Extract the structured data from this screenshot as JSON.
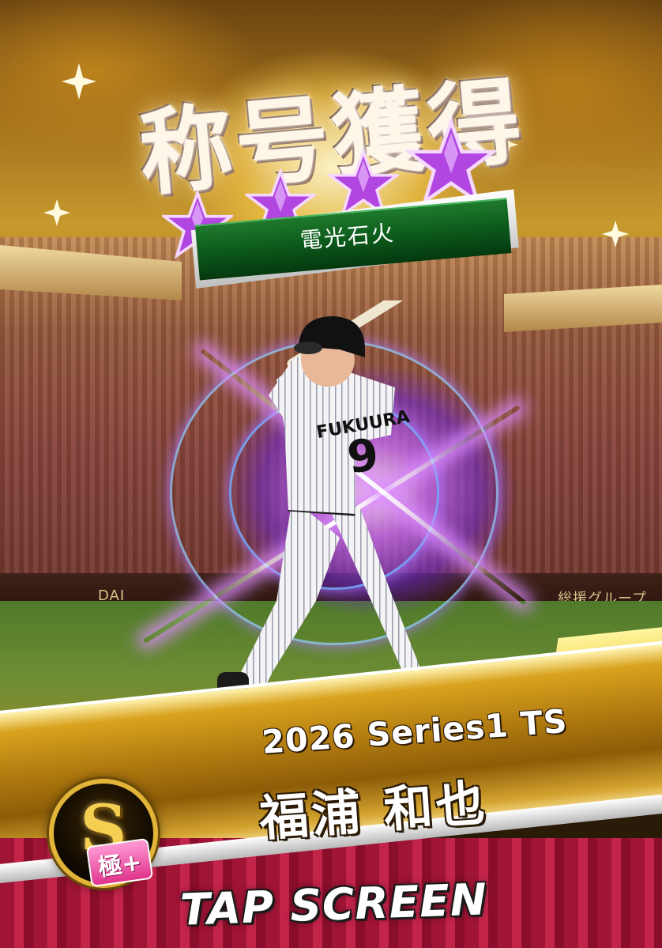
{
  "header": {
    "title": "称号獲得",
    "star_count": 4
  },
  "title_banner": {
    "label": "電光石火"
  },
  "player": {
    "jersey_name": "FUKUURA",
    "jersey_number": "9"
  },
  "card": {
    "series": "2026 Series1 TS",
    "player_name": "福浦 和也"
  },
  "rank": {
    "letter": "S",
    "grade": "極+"
  },
  "stadium": {
    "left_sign": "DA​I",
    "right_sign": "総援グループ"
  },
  "footer": {
    "tap_label": "TAP SCREEN"
  },
  "colors": {
    "star": "#b246e0",
    "banner_green": "#0c5a1b",
    "gold": "#d9a21e",
    "burst": "#a65cff"
  }
}
